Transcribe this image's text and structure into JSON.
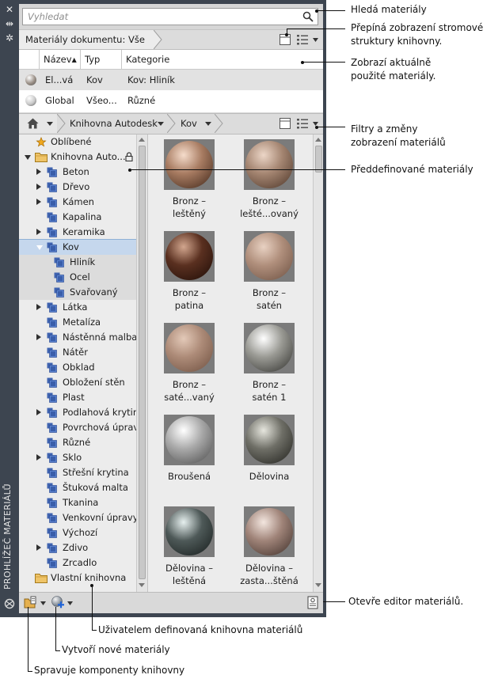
{
  "window": {
    "vertical_title": "PROHLÍŽEČ MATERIÁLŮ",
    "close_glyph": "✕",
    "pin_glyph": "⇹",
    "settings_glyph": "✲"
  },
  "search": {
    "placeholder": "Vyhledat"
  },
  "document_bar": {
    "breadcrumb": "Materiály dokumentu: Vše"
  },
  "document_table": {
    "columns": [
      "Název",
      "Typ",
      "Kategorie"
    ],
    "sort_indicator": "▲",
    "rows": [
      {
        "name": "El...vá",
        "type": "Kov",
        "category": "Kov: Hliník",
        "swatch": "#9a8f86"
      },
      {
        "name": "Global",
        "type": "Všeo...",
        "category": "Různé",
        "swatch": "#c9c9c9"
      }
    ]
  },
  "library_bar": {
    "home_icon": "home-icon",
    "crumbs": [
      "Knihovna Autodesk",
      "Kov"
    ]
  },
  "tree": {
    "items": [
      {
        "label": "Oblíbené",
        "level": 0,
        "icon": "star-icon",
        "expand": "none"
      },
      {
        "label": "Knihovna Auto...",
        "level": 0,
        "icon": "folder-icon",
        "expand": "open",
        "locked": true
      },
      {
        "label": "Beton",
        "level": 1,
        "icon": "category-icon",
        "expand": "closed"
      },
      {
        "label": "Dřevo",
        "level": 1,
        "icon": "category-icon",
        "expand": "closed"
      },
      {
        "label": "Kámen",
        "level": 1,
        "icon": "category-icon",
        "expand": "closed"
      },
      {
        "label": "Kapalina",
        "level": 1,
        "icon": "category-icon",
        "expand": "none"
      },
      {
        "label": "Keramika",
        "level": 1,
        "icon": "category-icon",
        "expand": "closed"
      },
      {
        "label": "Kov",
        "level": 1,
        "icon": "category-icon",
        "expand": "open",
        "selected": true
      },
      {
        "label": "Hliník",
        "level": 2,
        "icon": "category-icon",
        "expand": "none",
        "sub": true
      },
      {
        "label": "Ocel",
        "level": 2,
        "icon": "category-icon",
        "expand": "none",
        "sub": true
      },
      {
        "label": "Svařovaný",
        "level": 2,
        "icon": "category-icon",
        "expand": "none",
        "sub": true
      },
      {
        "label": "Látka",
        "level": 1,
        "icon": "category-icon",
        "expand": "closed"
      },
      {
        "label": "Metalíza",
        "level": 1,
        "icon": "category-icon",
        "expand": "none"
      },
      {
        "label": "Nástěnná malba",
        "level": 1,
        "icon": "category-icon",
        "expand": "closed"
      },
      {
        "label": "Nátěr",
        "level": 1,
        "icon": "category-icon",
        "expand": "none"
      },
      {
        "label": "Obklad",
        "level": 1,
        "icon": "category-icon",
        "expand": "none"
      },
      {
        "label": "Obložení stěn",
        "level": 1,
        "icon": "category-icon",
        "expand": "none"
      },
      {
        "label": "Plast",
        "level": 1,
        "icon": "category-icon",
        "expand": "none"
      },
      {
        "label": "Podlahová krytina",
        "level": 1,
        "icon": "category-icon",
        "expand": "closed"
      },
      {
        "label": "Povrchová úprava",
        "level": 1,
        "icon": "category-icon",
        "expand": "none"
      },
      {
        "label": "Různé",
        "level": 1,
        "icon": "category-icon",
        "expand": "none"
      },
      {
        "label": "Sklo",
        "level": 1,
        "icon": "category-icon",
        "expand": "closed"
      },
      {
        "label": "Střešní krytina",
        "level": 1,
        "icon": "category-icon",
        "expand": "none"
      },
      {
        "label": "Štuková malta",
        "level": 1,
        "icon": "category-icon",
        "expand": "none"
      },
      {
        "label": "Tkanina",
        "level": 1,
        "icon": "category-icon",
        "expand": "none"
      },
      {
        "label": "Venkovní úpravy",
        "level": 1,
        "icon": "category-icon",
        "expand": "none"
      },
      {
        "label": "Výchozí",
        "level": 1,
        "icon": "category-icon",
        "expand": "none"
      },
      {
        "label": "Zdivo",
        "level": 1,
        "icon": "category-icon",
        "expand": "closed"
      },
      {
        "label": "Zrcadlo",
        "level": 1,
        "icon": "category-icon",
        "expand": "none"
      },
      {
        "label": "Vlastní knihovna",
        "level": 0,
        "icon": "folder-icon",
        "expand": "none"
      }
    ]
  },
  "materials": [
    {
      "label": "Bronz –\nleštěný",
      "base": "#a87c62",
      "hi": "#f5dccb",
      "dark": "#3e2518"
    },
    {
      "label": "Bronz –\nlešté...ovaný",
      "base": "#a58672",
      "hi": "#ecd6c7",
      "dark": "#4a3326"
    },
    {
      "label": "Bronz –\npatina",
      "base": "#5a3020",
      "hi": "#d2a68e",
      "dark": "#1d0c06"
    },
    {
      "label": "Bronz –\nsatén",
      "base": "#b08f7c",
      "hi": "#e8d1c2",
      "dark": "#6b4f40"
    },
    {
      "label": "Bronz –\nsaté...vaný",
      "base": "#ad8b78",
      "hi": "#e3c9b8",
      "dark": "#6d4f3f"
    },
    {
      "label": "Bronz –\nsatén 1",
      "base": "#9a9a94",
      "hi": "#ffffff",
      "dark": "#2f2f2c"
    },
    {
      "label": "Broušená",
      "base": "#a9a9a9",
      "hi": "#ffffff",
      "dark": "#4a4a4a"
    },
    {
      "label": "Dělovina",
      "base": "#6f6f67",
      "hi": "#e6e6de",
      "dark": "#1f1f1b"
    },
    {
      "label": "Dělovina –\nleštěná",
      "base": "#4e5958",
      "hi": "#e6f0ef",
      "dark": "#151b1a"
    },
    {
      "label": "Dělovina –\nzasta...štěná",
      "base": "#a08479",
      "hi": "#f3e6df",
      "dark": "#3d2e28"
    }
  ],
  "callouts": [
    {
      "text": "Hledá materiály"
    },
    {
      "text": "Přepíná zobrazení stromové\nstruktury knihovny."
    },
    {
      "text": "Zobrazí aktuálně\npoužité materiály."
    },
    {
      "text": "Filtry a změny\nzobrazení materiálů"
    },
    {
      "text": "Předdefinované materiály"
    },
    {
      "text": "Otevře editor materiálů."
    },
    {
      "text": "Uživatelem definovaná knihovna materiálů"
    },
    {
      "text": "Vytvoří nové materiály"
    },
    {
      "text": "Spravuje komponenty knihovny"
    }
  ]
}
